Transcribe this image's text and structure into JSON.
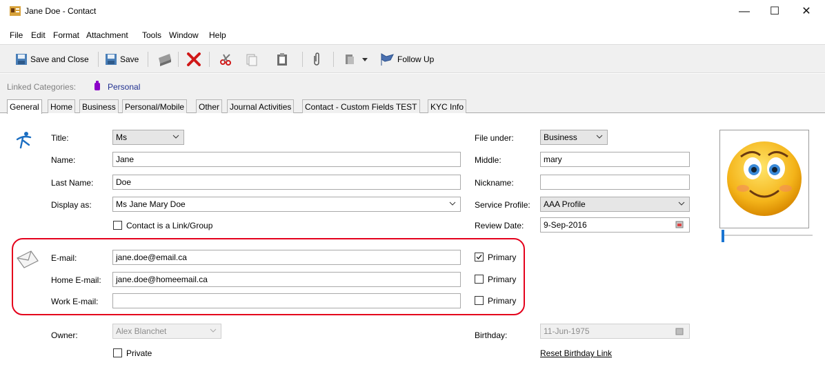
{
  "window": {
    "title": "Jane Doe - Contact",
    "controls": {
      "minimize": "—",
      "maximize": "☐",
      "close": "✕"
    }
  },
  "menu": [
    "File",
    "Edit",
    "Format",
    "Attachment",
    "Tools",
    "Window",
    "Help"
  ],
  "toolbar": {
    "save_close": "Save and Close",
    "save": "Save",
    "follow_up": "Follow Up"
  },
  "categories": {
    "label": "Linked Categories:",
    "value": "Personal",
    "color": "#8b00c8"
  },
  "tabs": [
    "General",
    "Home",
    "Business",
    "Personal/Mobile",
    "Other",
    "Journal Activities",
    "Contact - Custom Fields TEST",
    "KYC Info"
  ],
  "form": {
    "title_label": "Title:",
    "title_value": "Ms",
    "name_label": "Name:",
    "name_value": "Jane",
    "lastname_label": "Last Name:",
    "lastname_value": "Doe",
    "display_label": "Display as:",
    "display_value": "Ms Jane Mary Doe",
    "link_group_label": "Contact is a Link/Group",
    "file_under_label": "File under:",
    "file_under_value": "Business",
    "middle_label": "Middle:",
    "middle_value": "mary",
    "nickname_label": "Nickname:",
    "nickname_value": "",
    "service_profile_label": "Service Profile:",
    "service_profile_value": "AAA Profile",
    "review_date_label": "Review Date:",
    "review_date_value": "9-Sep-2016"
  },
  "emails": {
    "email_label": "E-mail:",
    "email_value": "jane.doe@email.ca",
    "email_primary": true,
    "home_label": "Home E-mail:",
    "home_value": "jane.doe@homeemail.ca",
    "home_primary": false,
    "work_label": "Work E-mail:",
    "work_value": "",
    "work_primary": false,
    "primary_label": "Primary"
  },
  "owner": {
    "label": "Owner:",
    "value": "Alex Blanchet",
    "private_label": "Private",
    "birthday_label": "Birthday:",
    "birthday_value": "11-Jun-1975",
    "reset_link": "Reset Birthday Link"
  }
}
